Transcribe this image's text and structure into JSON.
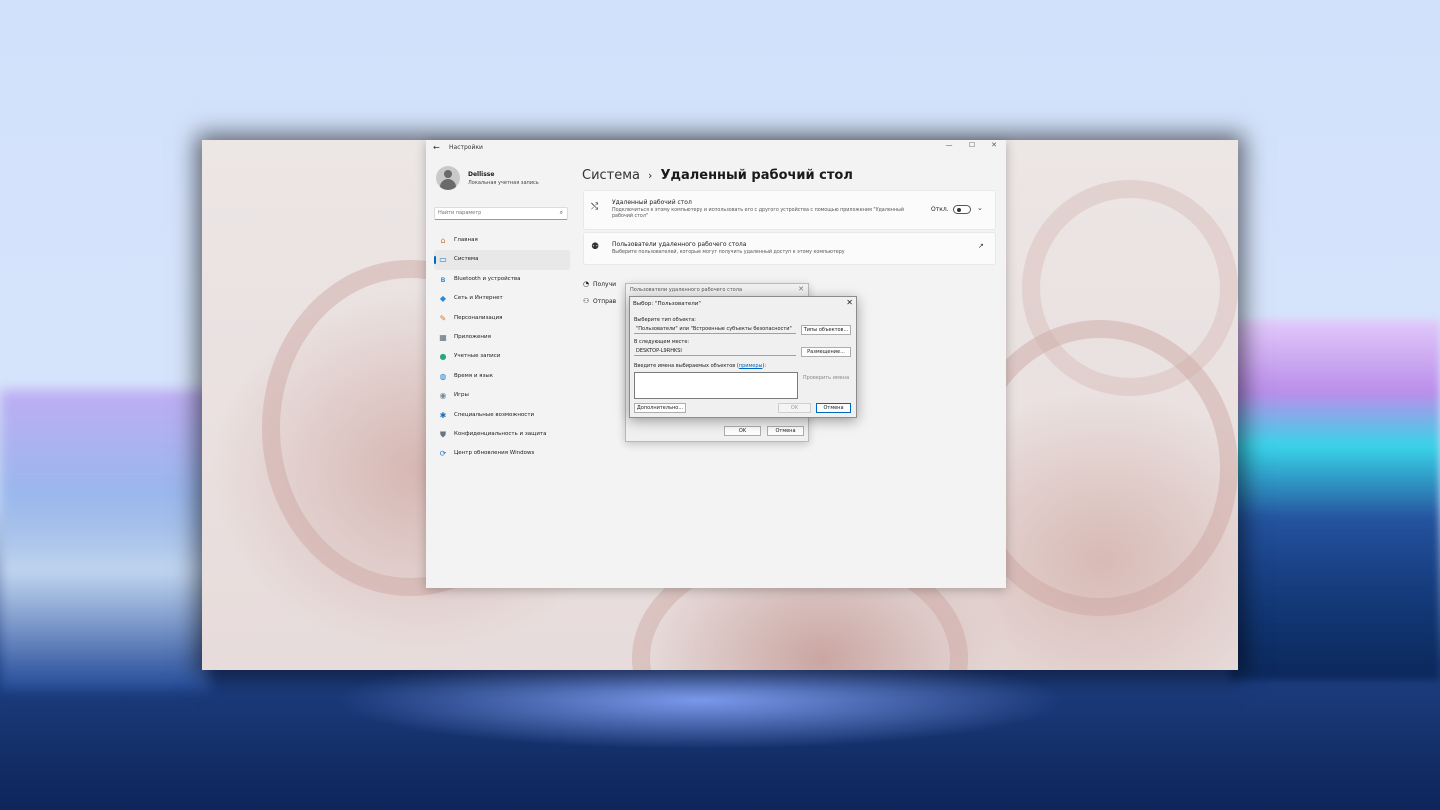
{
  "window": {
    "app_title": "Настройки",
    "controls": {
      "minimize": "—",
      "maximize": "☐",
      "close": "✕"
    }
  },
  "user": {
    "name": "Dellisse",
    "subtitle": "Локальная учетная запись"
  },
  "search": {
    "placeholder": "Найти параметр"
  },
  "sidebar": {
    "items": [
      {
        "label": "Главная",
        "icon": "home-icon",
        "glyph": "⌂",
        "color": "#c8743a"
      },
      {
        "label": "Система",
        "icon": "monitor-icon",
        "glyph": "▭",
        "color": "#0078d4",
        "active": true
      },
      {
        "label": "Bluetooth и устройства",
        "icon": "bluetooth-icon",
        "glyph": "ʙ",
        "color": "#0067c0"
      },
      {
        "label": "Сеть и Интернет",
        "icon": "wifi-icon",
        "glyph": "◆",
        "color": "#2b88d8"
      },
      {
        "label": "Персонализация",
        "icon": "brush-icon",
        "glyph": "✎",
        "color": "#d47a2a"
      },
      {
        "label": "Приложения",
        "icon": "apps-icon",
        "glyph": "▦",
        "color": "#5a6a7a"
      },
      {
        "label": "Учетные записи",
        "icon": "account-icon",
        "glyph": "●",
        "color": "#2aa87a"
      },
      {
        "label": "Время и язык",
        "icon": "globe-icon",
        "glyph": "◍",
        "color": "#1f7fcf"
      },
      {
        "label": "Игры",
        "icon": "gamepad-icon",
        "glyph": "◉",
        "color": "#7a8a9a"
      },
      {
        "label": "Специальные возможности",
        "icon": "accessibility-icon",
        "glyph": "✱",
        "color": "#1a6fc0"
      },
      {
        "label": "Конфиденциальность и защита",
        "icon": "shield-icon",
        "glyph": "⛊",
        "color": "#6a7480"
      },
      {
        "label": "Центр обновления Windows",
        "icon": "update-icon",
        "glyph": "⟳",
        "color": "#1678d2"
      }
    ]
  },
  "breadcrumb": {
    "parent": "Система",
    "separator": "›",
    "current": "Удаленный рабочий стол"
  },
  "cards": {
    "rdp": {
      "title": "Удаленный рабочий стол",
      "description": "Подключиться к этому компьютеру и использовать его с другого устройства с помощью приложения \"Удаленный рабочий стол\"",
      "toggle_label": "Откл.",
      "toggle_on": false
    },
    "users": {
      "title": "Пользователи удаленного рабочего стола",
      "description": "Выберите пользователей, которые могут получить удаленный доступ к этому компьютеру"
    }
  },
  "related": {
    "item1": "Получи",
    "item2": "Отправ"
  },
  "dialog_back": {
    "title": "Пользователи удаленного рабочего стола",
    "ok": "OK",
    "cancel": "Отмена"
  },
  "dialog": {
    "title": "Выбор: \"Пользователи\"",
    "object_type_label": "Выберите тип объекта:",
    "object_type_value": "\"Пользователи\" или \"Встроенные субъекты безопасности\"",
    "object_types_button": "Типы объектов...",
    "location_label": "В следующем месте:",
    "location_value": "DESKTOP-L9RHKSI",
    "locations_button": "Размещение...",
    "names_label": "Введите имена выбираемых объектов (",
    "names_link": "примеры",
    "names_label_end": "):",
    "check_names_button": "Проверить имена",
    "advanced_button": "Дополнительно...",
    "ok": "OK",
    "cancel": "Отмена"
  }
}
